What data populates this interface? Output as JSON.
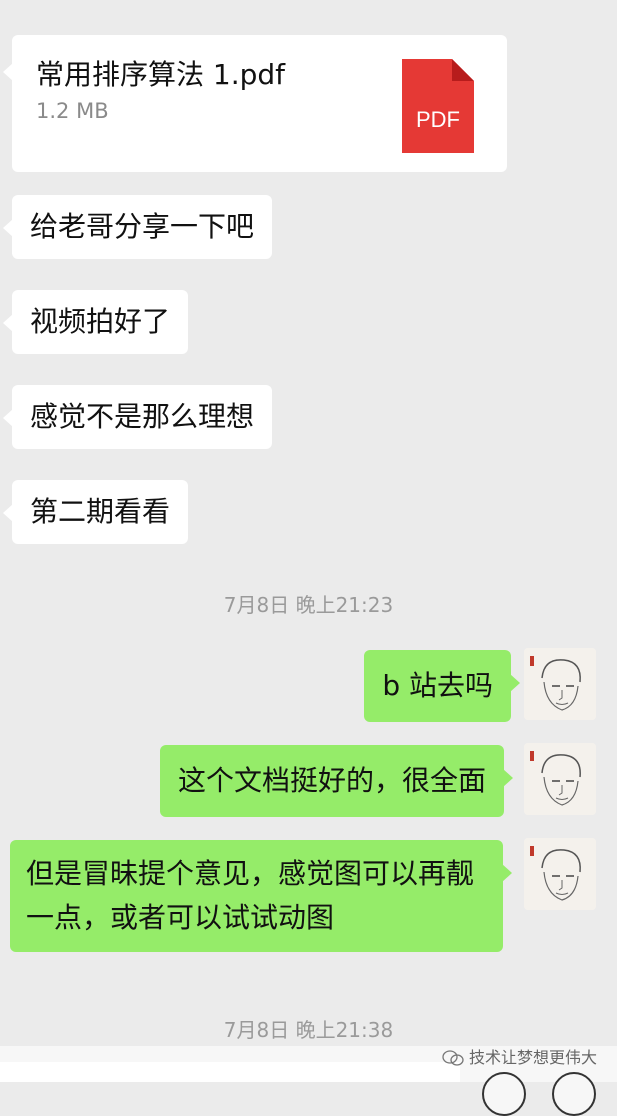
{
  "file": {
    "name": "常用排序算法 1.pdf",
    "size": "1.2 MB",
    "badge": "PDF"
  },
  "incoming_messages": [
    "给老哥分享一下吧",
    "视频拍好了",
    "感觉不是那么理想",
    "第二期看看"
  ],
  "timestamp1": "7月8日 晚上21:23",
  "outgoing_messages": [
    "b 站去吗",
    "这个文档挺好的，很全面",
    "但是冒昧提个意见，感觉图可以再靓一点，或者可以试试动图"
  ],
  "timestamp2": "7月8日 晚上21:38",
  "watermark": "技术让梦想更伟大",
  "colors": {
    "background": "#ebebeb",
    "outgoing_bubble": "#95ec69",
    "incoming_bubble": "#ffffff",
    "pdf_red": "#e53935"
  },
  "icons": {
    "file": "pdf-icon",
    "avatar": "sketch-portrait-avatar",
    "watermark": "wechat-icon"
  }
}
